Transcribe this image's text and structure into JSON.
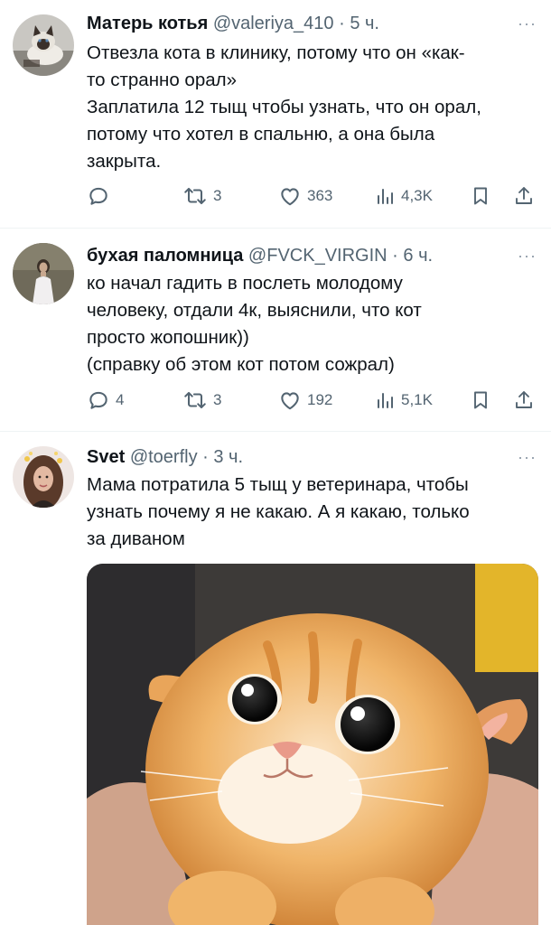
{
  "tweets": [
    {
      "name": "Матерь котья",
      "handle": "@valeriya_410",
      "separator": "·",
      "time": "5 ч.",
      "lines": [
        "Отвезла кота в клинику, потому что он «как-",
        "то странно орал»",
        "Заплатила 12 тыщ чтобы узнать, что он орал,",
        "потому что хотел в спальню, а она была",
        "закрыта."
      ],
      "replies": "",
      "retweets": "3",
      "likes": "363",
      "views": "4,3K"
    },
    {
      "name": "бухая паломница",
      "handle": "@FVCK_VIRGIN",
      "separator": "·",
      "time": "6 ч.",
      "lines": [
        "ко начал гадить в послеть молодому",
        "человеку, отдали 4к, выяснили, что кот",
        "просто жопошник))",
        "(справку об этом кот потом сожрал)"
      ],
      "replies": "4",
      "retweets": "3",
      "likes": "192",
      "views": "5,1K"
    },
    {
      "name": "Svet",
      "handle": "@toerfly",
      "separator": "·",
      "time": "3 ч.",
      "lines": [
        "Мама потратила 5 тыщ у ветеринара, чтобы",
        "узнать почему я не какаю. А я какаю, только",
        "за диваном"
      ]
    }
  ],
  "more_label": "···",
  "icons": {
    "reply": "reply-icon",
    "retweet": "retweet-icon",
    "like": "like-icon",
    "views": "views-icon",
    "bookmark": "bookmark-icon",
    "share": "share-icon",
    "more": "more-icon"
  },
  "colors": {
    "text": "#0f1419",
    "secondary": "#536471",
    "divider": "#eff3f4"
  }
}
